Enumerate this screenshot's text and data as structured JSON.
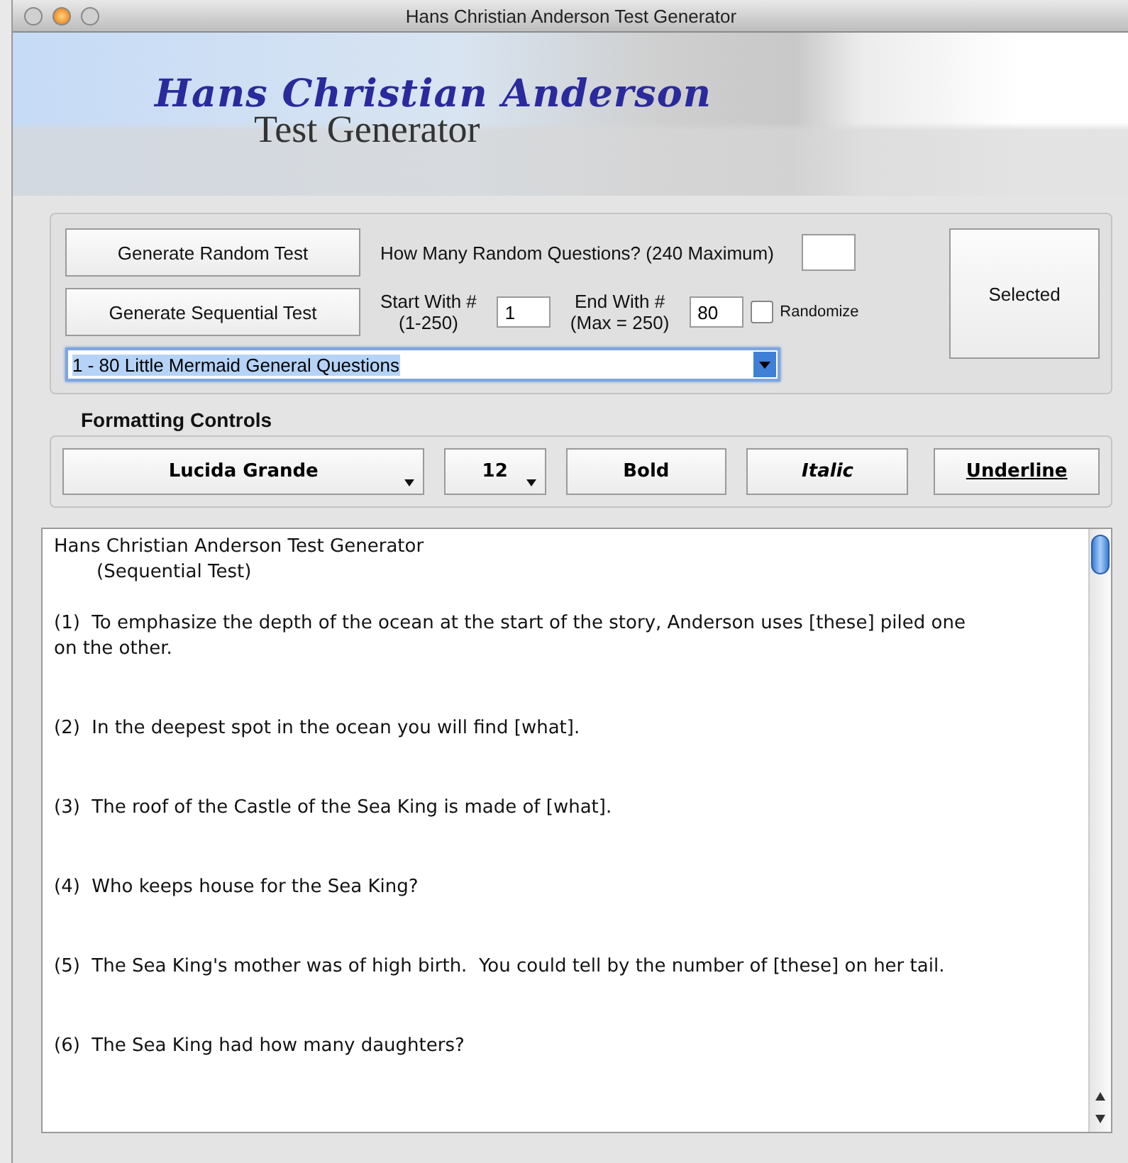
{
  "window": {
    "title": "Hans Christian Anderson Test Generator"
  },
  "banner": {
    "title": "Hans Christian Anderson",
    "subtitle": "Test Generator"
  },
  "generator": {
    "random_button": "Generate Random Test",
    "random_label": "How Many Random Questions? (240 Maximum)",
    "sequential_button": "Generate Sequential Test",
    "start_label": "Start With #",
    "start_hint": "(1-250)",
    "start_value": "1",
    "end_label": "End With #",
    "end_hint": "(Max = 250)",
    "end_value": "80",
    "randomize": {
      "label": "Randomize",
      "checked": false
    },
    "selected_button": "Selected",
    "question_set": "1 - 80 Little Mermaid General Questions"
  },
  "formatting": {
    "heading": "Formatting Controls",
    "font": "Lucida Grande",
    "size": "12",
    "buttons": [
      {
        "label": "Bold",
        "kind": "bold"
      },
      {
        "label": "Italic",
        "kind": "italic"
      },
      {
        "label": "Underline",
        "kind": "underline"
      }
    ]
  },
  "output": {
    "heading": "Hans Christian Anderson Test Generator",
    "subheading": "(Sequential Test)",
    "questions": [
      "(1)  To emphasize the depth of the ocean at the start of the story, Anderson uses [these] piled one on the other.",
      "(2)  In the deepest spot in the ocean you will find [what].",
      "(3)  The roof of the Castle of the Sea King is made of [what].",
      "(4)  Who keeps house for the Sea King?",
      "(5)  The Sea King's mother was of high birth.  You could tell by the number of [these] on her tail.",
      "(6)  The Sea King had how many daughters?"
    ]
  }
}
